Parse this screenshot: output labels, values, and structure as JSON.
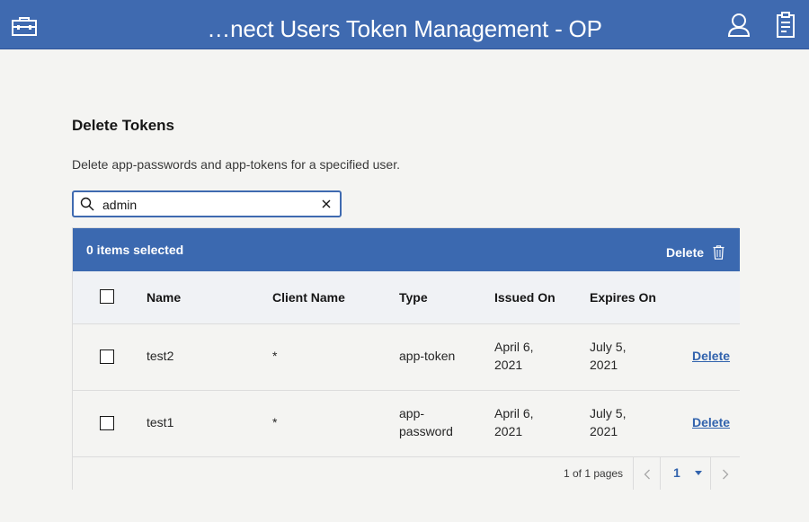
{
  "header": {
    "title": "…nect Users Token Management - OP",
    "icons": [
      "toolbox-icon",
      "user-icon",
      "clipboard-icon"
    ],
    "color": "#3f6ab0"
  },
  "section": {
    "title": "Delete Tokens",
    "description": "Delete app-passwords and app-tokens for a specified user."
  },
  "search": {
    "value": "admin",
    "icon": "search-icon",
    "clear_icon": "close-icon"
  },
  "batch": {
    "selected_text": "0 items selected",
    "delete_label": "Delete",
    "delete_icon": "trash-icon"
  },
  "table": {
    "columns": [
      "Name",
      "Client Name",
      "Type",
      "Issued On",
      "Expires On"
    ],
    "rows": [
      {
        "name": "test2",
        "client": "*",
        "type": [
          "app-token"
        ],
        "issued": [
          "April 6,",
          "2021"
        ],
        "expires": [
          "July 5,",
          "2021"
        ],
        "action": "Delete"
      },
      {
        "name": "test1",
        "client": "*",
        "type": [
          "app-",
          "password"
        ],
        "issued": [
          "April 6,",
          "2021"
        ],
        "expires": [
          "July 5,",
          "2021"
        ],
        "action": "Delete"
      }
    ]
  },
  "pagination": {
    "pages_text": "1 of 1 pages",
    "current_page": "1",
    "accent": "#3263ad"
  }
}
